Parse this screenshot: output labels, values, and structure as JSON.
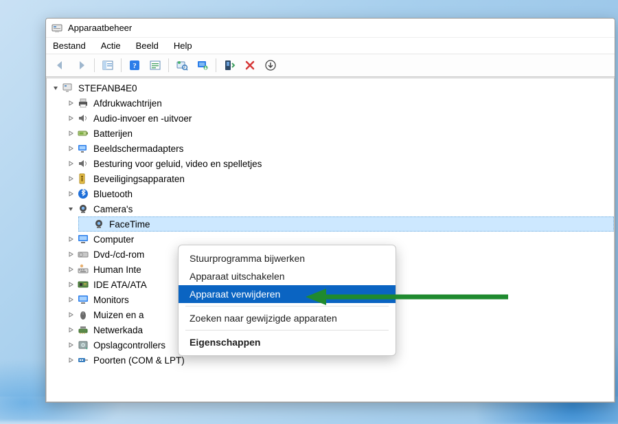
{
  "window": {
    "title": "Apparaatbeheer"
  },
  "menubar": {
    "file": "Bestand",
    "action": "Actie",
    "view": "Beeld",
    "help": "Help"
  },
  "toolbar": {
    "back": "back-arrow-icon",
    "forward": "forward-arrow-icon",
    "show_hide": "tree-pane-icon",
    "help": "help-icon",
    "props": "properties-icon",
    "scan": "scan-icon",
    "update": "monitor-update-icon",
    "enable": "enable-device-icon",
    "remove": "remove-icon",
    "down": "arrow-down-icon"
  },
  "tree": {
    "root": "STEFANB4E0",
    "nodes": [
      {
        "label": "Afdrukwachtrijen",
        "icon": "printer-icon",
        "expand": "closed"
      },
      {
        "label": "Audio-invoer en -uitvoer",
        "icon": "speaker-icon",
        "expand": "closed"
      },
      {
        "label": "Batterijen",
        "icon": "battery-icon",
        "expand": "closed"
      },
      {
        "label": "Beeldschermadapters",
        "icon": "display-adapter-icon",
        "expand": "closed"
      },
      {
        "label": "Besturing voor geluid, video en spelletjes",
        "icon": "speaker-icon",
        "expand": "closed"
      },
      {
        "label": "Beveiligingsapparaten",
        "icon": "security-icon",
        "expand": "closed"
      },
      {
        "label": "Bluetooth",
        "icon": "bluetooth-icon",
        "expand": "closed"
      },
      {
        "label": "Camera's",
        "icon": "camera-icon",
        "expand": "open",
        "children": [
          {
            "label": "FaceTime",
            "icon": "camera-icon",
            "selected": true
          }
        ]
      },
      {
        "label": "Computer",
        "icon": "monitor-icon",
        "expand": "closed"
      },
      {
        "label": "Dvd-/cd-rom",
        "icon": "disc-drive-icon",
        "expand": "closed"
      },
      {
        "label": "Human Inte",
        "icon": "hid-icon",
        "expand": "closed"
      },
      {
        "label": "IDE ATA/ATA",
        "icon": "ide-icon",
        "expand": "closed"
      },
      {
        "label": "Monitors",
        "icon": "monitor-icon",
        "expand": "closed"
      },
      {
        "label": "Muizen en a",
        "icon": "mouse-icon",
        "expand": "closed"
      },
      {
        "label": "Netwerkada",
        "icon": "network-icon",
        "expand": "closed"
      },
      {
        "label": "Opslagcontrollers",
        "icon": "storage-icon",
        "expand": "closed"
      },
      {
        "label": "Poorten (COM & LPT)",
        "icon": "port-icon",
        "expand": "closed"
      }
    ]
  },
  "context_menu": {
    "items": [
      {
        "label": "Stuurprogramma bijwerken",
        "highlight": false
      },
      {
        "label": "Apparaat uitschakelen",
        "highlight": false
      },
      {
        "label": "Apparaat verwijderen",
        "highlight": true
      },
      {
        "sep": true
      },
      {
        "label": "Zoeken naar gewijzigde apparaten",
        "highlight": false
      },
      {
        "sep": true
      },
      {
        "label": "Eigenschappen",
        "highlight": false,
        "bold": true
      }
    ]
  },
  "annotation": {
    "arrow_color": "#1f8a2f"
  }
}
